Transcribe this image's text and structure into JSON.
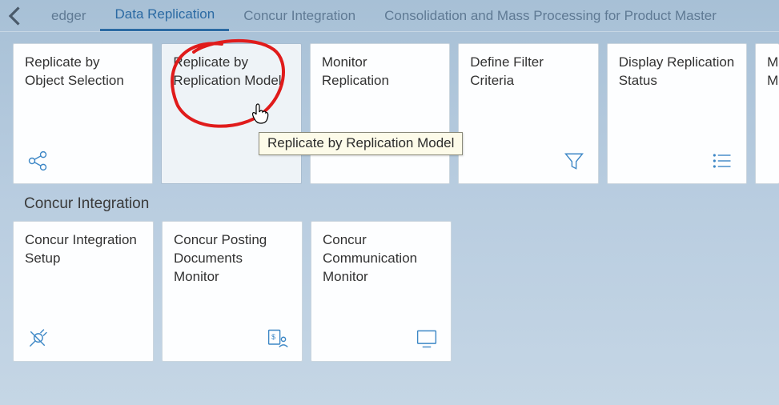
{
  "nav": {
    "back_icon": "chevron-left",
    "tabs": {
      "partial_left": "edger",
      "active": "Data Replication",
      "concur": "Concur Integration",
      "consolidation": "Consolidation and Mass Processing for Product Master"
    }
  },
  "groups": {
    "data_replication": {
      "tiles": [
        {
          "title": "Replicate by Object Selection",
          "icon": "share"
        },
        {
          "title": "Replicate by Replication Model",
          "icon": ""
        },
        {
          "title": "Monitor Replication",
          "icon": ""
        },
        {
          "title": "Define Filter Criteria",
          "icon": "filter"
        },
        {
          "title": "Display Replication Status",
          "icon": "list"
        }
      ],
      "partial_tile_text": "Ma\nMa"
    },
    "concur": {
      "title": "Concur Integration",
      "tiles": [
        {
          "title": "Concur Integration Setup",
          "icon": "plug"
        },
        {
          "title": "Concur Posting Documents Monitor",
          "icon": "doc-person"
        },
        {
          "title": "Concur Communication Monitor",
          "icon": "monitor"
        }
      ]
    },
    "bottom_cut": "Consolidation and Mass Processing for Product Master"
  },
  "tooltip": "Replicate by Replication Model",
  "colors": {
    "accent": "#2b6aa3",
    "icon": "#3d87c6",
    "annotation": "#e01b1b"
  }
}
